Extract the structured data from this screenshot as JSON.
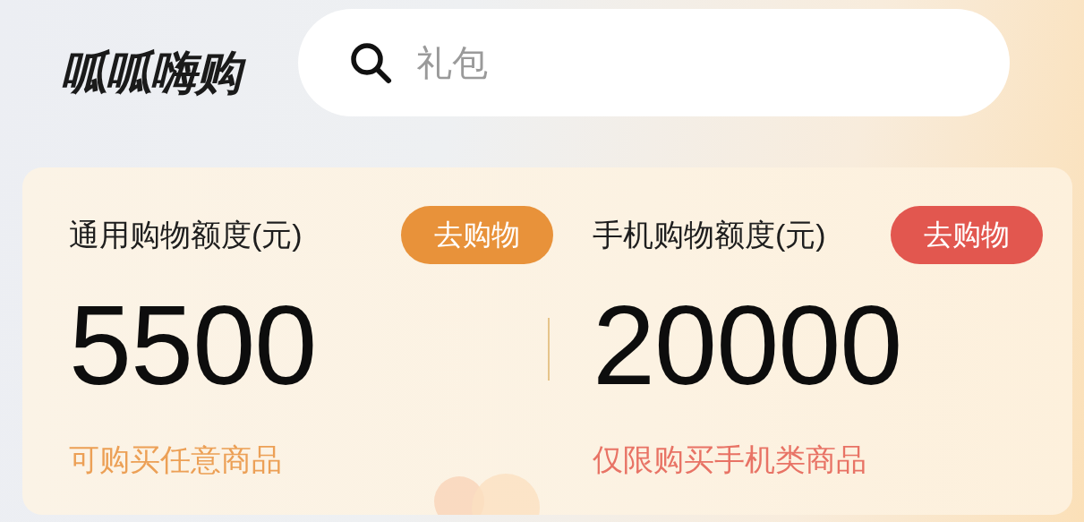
{
  "header": {
    "logo": "呱呱嗨购",
    "search": {
      "placeholder": "礼包"
    }
  },
  "quotas": [
    {
      "title": "通用购物额度(元)",
      "button": "去购物",
      "amount": "5500",
      "note": "可购买任意商品",
      "color": "#e8923a"
    },
    {
      "title": "手机购物额度(元)",
      "button": "去购物",
      "amount": "20000",
      "note": "仅限购买手机类商品",
      "color": "#e2574f"
    }
  ]
}
